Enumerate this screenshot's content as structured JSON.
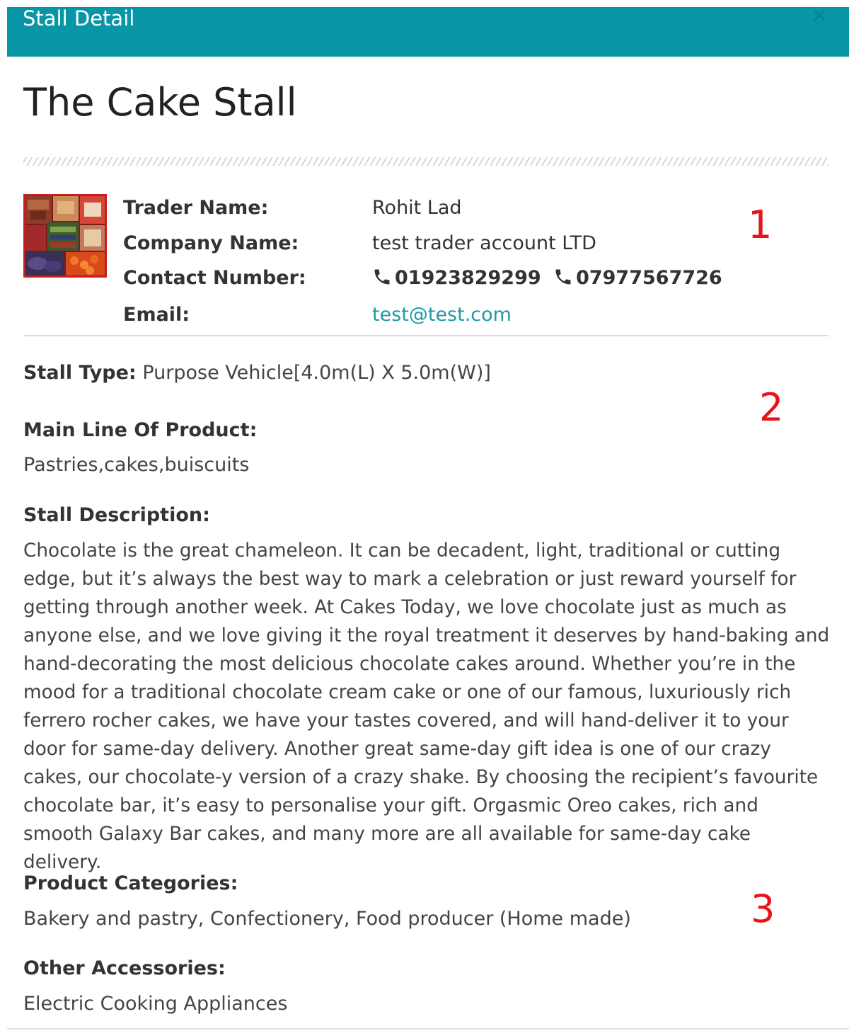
{
  "modal": {
    "header_title": "Stall Detail",
    "close_glyph": "×",
    "header_color": "#0896a6"
  },
  "stall": {
    "title": "The Cake Stall",
    "thumbnail_icon": "food-collage-image"
  },
  "trader": {
    "trader_name_label": "Trader Name:",
    "trader_name": "Rohit Lad",
    "company_name_label": "Company Name:",
    "company_name": "test trader account LTD",
    "contact_label": "Contact Number:",
    "phone_icon": "phone-icon",
    "phone_1": "01923829299",
    "phone_2": "07977567726",
    "email_label": "Email:",
    "email": "test@test.com",
    "link_color": "#1f9aa6"
  },
  "details": {
    "stall_type_label": "Stall Type:",
    "stall_type_value": "Purpose Vehicle[4.0m(L) X 5.0m(W)]",
    "main_line_label": "Main Line Of Product:",
    "main_line_value": "Pastries,cakes,buiscuits",
    "description_label": "Stall Description:",
    "description_value": "Chocolate is the great chameleon. It can be decadent, light, traditional or cutting edge, but it’s always the best way to mark a celebration or just reward yourself for getting through another week. At Cakes Today, we love chocolate just as much as anyone else, and we love giving it the royal treatment it deserves by hand-baking and hand-decorating the most delicious chocolate cakes around. Whether you’re in the mood for a traditional chocolate cream cake or one of our famous, luxuriously rich ferrero rocher cakes, we have your tastes covered, and will hand-deliver it to your door for same-day delivery. Another great same-day gift idea is one of our crazy cakes, our chocolate-y version of a crazy shake. By choosing the recipient’s favourite chocolate bar, it’s easy to personalise your gift. Orgasmic Oreo cakes, rich and smooth Galaxy Bar cakes, and many more are all available for same-day cake delivery.",
    "categories_label": "Product Categories:",
    "categories_value": "Bakery and pastry, Confectionery, Food producer (Home made)",
    "accessories_label": "Other Accessories:",
    "accessories_value": "Electric Cooking Appliances"
  },
  "annotations": {
    "one": "1",
    "two": "2",
    "three": "3",
    "color": "#e8141c"
  }
}
